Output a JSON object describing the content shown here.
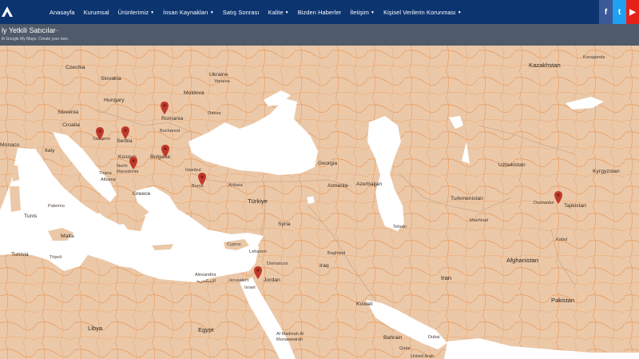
{
  "nav": {
    "items": [
      {
        "label": "Anasayfa",
        "dropdown": false
      },
      {
        "label": "Kurumsal",
        "dropdown": false
      },
      {
        "label": "Ürünlerimiz",
        "dropdown": true
      },
      {
        "label": "İnsan Kaynakları",
        "dropdown": true
      },
      {
        "label": "Satış Sonrası",
        "dropdown": false
      },
      {
        "label": "Kalite",
        "dropdown": true
      },
      {
        "label": "Bizden Haberler",
        "dropdown": false
      },
      {
        "label": "İletişim",
        "dropdown": true
      },
      {
        "label": "Kişisel Verilerin Korunması",
        "dropdown": true
      }
    ],
    "social": {
      "facebook": "f",
      "twitter": "t",
      "youtube": "▶"
    },
    "colors": {
      "bar": "#0c3570",
      "facebook": "#3b5998",
      "twitter": "#1ea1f2",
      "youtube": "#e62117"
    }
  },
  "map": {
    "title": "ly Yetkili Satıcılar",
    "subtitle": "th Google My Maps. Create your own.",
    "colors": {
      "land": "#ebc8a8",
      "water": "#ffffff",
      "roads": "#e8904a",
      "pin": "#c0392b"
    },
    "countries": [
      {
        "name": "Czechia",
        "big": false
      },
      {
        "name": "Slovakia",
        "big": false
      },
      {
        "name": "Hungary",
        "big": false
      },
      {
        "name": "Slovenia",
        "big": false
      },
      {
        "name": "Croatia",
        "big": false
      },
      {
        "name": "Italy",
        "big": false
      },
      {
        "name": "Monaco",
        "big": false
      },
      {
        "name": "Romania",
        "big": false
      },
      {
        "name": "Moldova",
        "big": false
      },
      {
        "name": "Ukraine",
        "big": false
      },
      {
        "name": "Україна",
        "big": false
      },
      {
        "name": "Serbia",
        "big": false
      },
      {
        "name": "Sarajevo",
        "big": false
      },
      {
        "name": "Bulgaria",
        "big": false
      },
      {
        "name": "Kosovo",
        "big": false
      },
      {
        "name": "North Macedonia",
        "big": false
      },
      {
        "name": "Tirana",
        "big": false
      },
      {
        "name": "Albania",
        "big": false
      },
      {
        "name": "Greece",
        "big": false
      },
      {
        "name": "Tunis",
        "big": false
      },
      {
        "name": "Palermo",
        "big": false
      },
      {
        "name": "Malta",
        "big": false
      },
      {
        "name": "Tunisia",
        "big": false
      },
      {
        "name": "Tripoli",
        "big": false
      },
      {
        "name": "Libya",
        "big": false
      },
      {
        "name": "Türkiye",
        "big": false
      },
      {
        "name": "İstanbul",
        "big": false
      },
      {
        "name": "Ankara",
        "big": false
      },
      {
        "name": "Georgia",
        "big": false
      },
      {
        "name": "Armenia",
        "big": false
      },
      {
        "name": "Azerbaijan",
        "big": false
      },
      {
        "name": "Syria",
        "big": false
      },
      {
        "name": "Lebanon",
        "big": false
      },
      {
        "name": "Cyprus",
        "big": false
      },
      {
        "name": "Damascus",
        "big": false
      },
      {
        "name": "Jordan",
        "big": false
      },
      {
        "name": "Jerusalem",
        "big": false
      },
      {
        "name": "Israel",
        "big": false
      },
      {
        "name": "Alexandria",
        "big": false
      },
      {
        "name": "الإسكندرية",
        "big": false
      },
      {
        "name": "Egypt",
        "big": false
      },
      {
        "name": "Iraq",
        "big": false
      },
      {
        "name": "Baghdad",
        "big": false
      },
      {
        "name": "Kuwait",
        "big": false
      },
      {
        "name": "Al Madinah Al Munawwarah",
        "big": false
      },
      {
        "name": "Bahrain",
        "big": false
      },
      {
        "name": "Qatar",
        "big": false
      },
      {
        "name": "Dubai",
        "big": false
      },
      {
        "name": "United Arab",
        "big": false
      },
      {
        "name": "Tehran",
        "big": false
      },
      {
        "name": "Iran",
        "big": false
      },
      {
        "name": "Turkmenistan",
        "big": false
      },
      {
        "name": "Mashhad",
        "big": false
      },
      {
        "name": "Uzbekistan",
        "big": false
      },
      {
        "name": "Kazakhstan",
        "big": false
      },
      {
        "name": "Kyrgyzstan",
        "big": false
      },
      {
        "name": "Tajikistan",
        "big": false
      },
      {
        "name": "Dushanbe",
        "big": false
      },
      {
        "name": "Afghanistan",
        "big": false
      },
      {
        "name": "Kabul",
        "big": false
      },
      {
        "name": "Pakistan",
        "big": false
      },
      {
        "name": "Karaganda",
        "big": false
      },
      {
        "name": "Odesa",
        "big": false
      },
      {
        "name": "Bucharest",
        "big": false
      },
      {
        "name": "Bursa",
        "big": false
      }
    ]
  }
}
